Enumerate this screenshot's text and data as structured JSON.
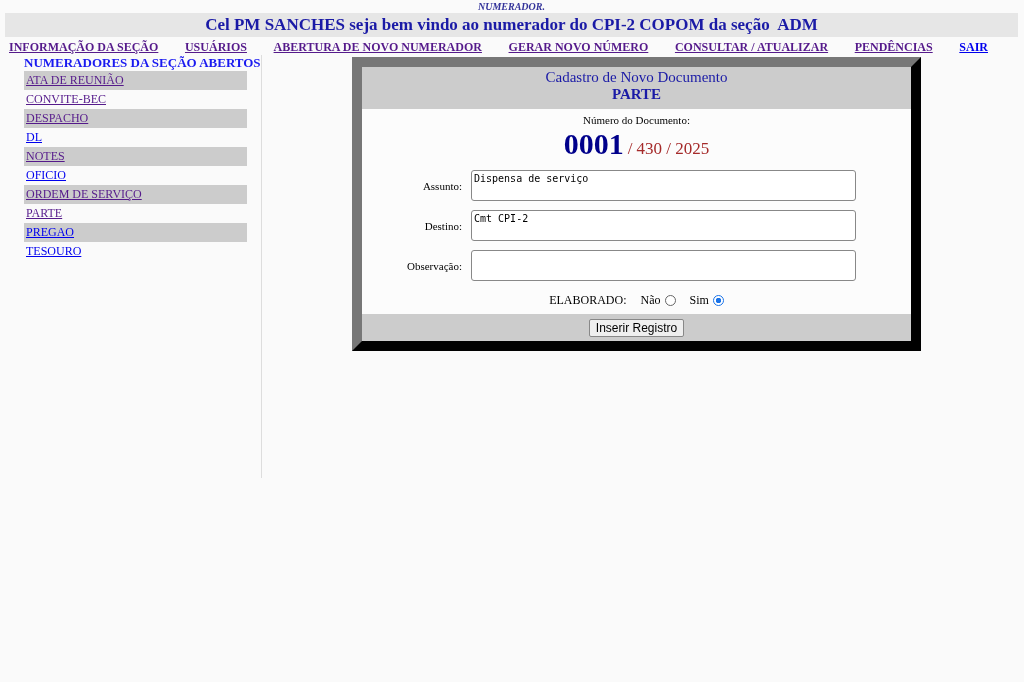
{
  "page_label": "NUMERADOR.",
  "welcome": "Cel PM SANCHES seja bem vindo ao numerador do CPI-2 COPOM da seção  ADM",
  "menu": [
    {
      "label": "INFORMAÇÃO DA SEÇÃO",
      "visited": true
    },
    {
      "label": "USUÁRIOS",
      "visited": true
    },
    {
      "label": "ABERTURA DE NOVO NUMERADOR",
      "visited": true
    },
    {
      "label": "GERAR NOVO NÚMERO",
      "visited": true
    },
    {
      "label": "CONSULTAR / ATUALIZAR",
      "visited": true
    },
    {
      "label": "PENDÊNCIAS",
      "visited": true
    },
    {
      "label": "SAIR",
      "visited": false
    }
  ],
  "sidebar": {
    "title": "NUMERADORES DA SEÇÃO ABERTOS",
    "items": [
      {
        "label": "ATA DE REUNIÃO",
        "visited": true
      },
      {
        "label": "CONVITE-BEC",
        "visited": true
      },
      {
        "label": "DESPACHO",
        "visited": true
      },
      {
        "label": "DL",
        "visited": false
      },
      {
        "label": "NOTES",
        "visited": true
      },
      {
        "label": "OFICIO",
        "visited": false
      },
      {
        "label": "ORDEM DE SERVIÇO",
        "visited": true
      },
      {
        "label": "PARTE",
        "visited": true
      },
      {
        "label": "PREGAO",
        "visited": false
      },
      {
        "label": "TESOURO",
        "visited": false
      }
    ]
  },
  "form": {
    "title": "Cadastro de Novo Documento",
    "doc_type": "PARTE",
    "number_label": "Número do Documento:",
    "number": "0001",
    "number_suffix": "/ 430 / 2025",
    "fields": [
      {
        "label": "Assunto:",
        "value": "Dispensa de serviço"
      },
      {
        "label": "Destino:",
        "value": "Cmt CPI-2"
      },
      {
        "label": "Observação:"
      }
    ],
    "elaborado": {
      "label": "ELABORADO:",
      "options": [
        {
          "label": "Não",
          "selected": false
        },
        {
          "label": "Sim",
          "selected": true
        }
      ]
    },
    "submit": "Inserir Registro"
  }
}
